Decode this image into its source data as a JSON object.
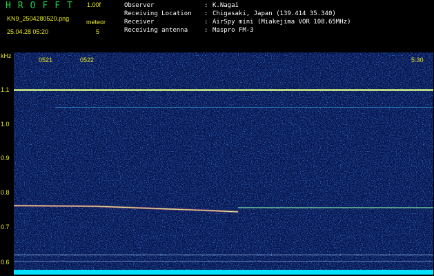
{
  "header": {
    "app_title": "HROFFT",
    "version": "1.00f",
    "filename": "KN9_2504280520.png",
    "mode": "meteor",
    "datetime": "25.04.28 05:20",
    "count": "5"
  },
  "info": {
    "observer_label": "Observer",
    "observer_value": "K.Nagai",
    "location_label": "Receiving Location",
    "location_value": "Chigasaki, Japan (139.414 35.340)",
    "receiver_label": "Receiver",
    "receiver_value": "AirSpy mini (Miakejima VOR 108.65MHz)",
    "antenna_label": "Receiving antenna",
    "antenna_value": "Maspro FM-3",
    "separator": ":"
  },
  "axis": {
    "unit": "kHz",
    "ticks": [
      "1.1",
      "1.0",
      "0.9",
      "0.8",
      "0.7",
      "0.6"
    ]
  },
  "time_labels": [
    "0521",
    "0522",
    "5:30"
  ],
  "colors": {
    "background": "#000000",
    "title_green": "#20d040",
    "label_yellow": "#e8e820",
    "spectrogram_base": "#06124a",
    "noise_floor": "#00e0ff"
  }
}
